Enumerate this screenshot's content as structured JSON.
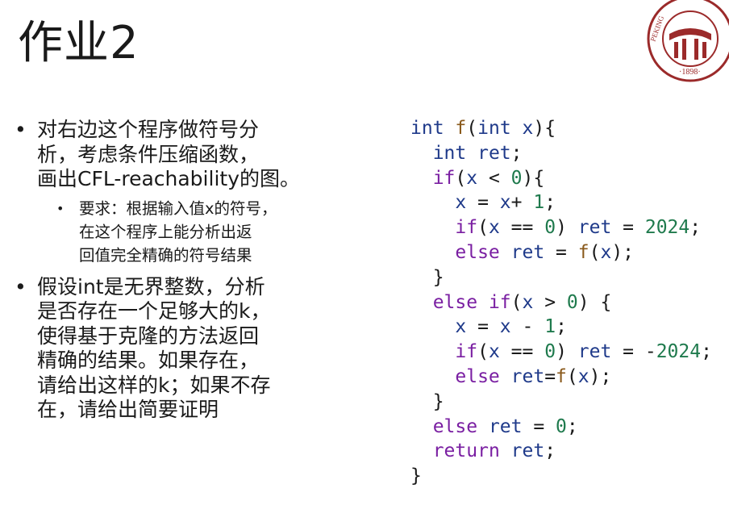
{
  "title": "作业2",
  "logo": {
    "name": "Peking University seal",
    "text_top": "PEKING",
    "text_year": "1898",
    "color": "#9b2a2a"
  },
  "bullets": [
    {
      "lines": [
        "对右边这个程序做符号分",
        "析，考虑条件压缩函数，",
        "画出CFL-reachability的图。"
      ],
      "sub": {
        "lines": [
          "要求：根据输入值x的符号，",
          "在这个程序上能分析出返",
          "回值完全精确的符号结果"
        ]
      }
    },
    {
      "lines": [
        "假设int是无界整数，分析",
        "是否存在一个足够大的k，",
        "使得基于克隆的方法返回",
        "精确的结果。如果存在，",
        "请给出这样的k；如果不存",
        "在，请给出简要证明"
      ]
    }
  ],
  "code_lines": [
    "int f(int x){",
    "  int ret;",
    "  if(x < 0){",
    "    x = x+ 1;",
    "    if(x == 0) ret = 2024;",
    "    else ret = f(x);",
    "  }",
    "  else if(x > 0) {",
    "    x = x - 1;",
    "    if(x == 0) ret = -2024;",
    "    else ret=f(x);",
    "  }",
    "  else ret = 0;",
    "  return ret;",
    "}"
  ],
  "colors": {
    "keyword": "#7a1fa2",
    "type": "#1f3a8a",
    "function": "#8a5a1c",
    "number": "#1f7a4d",
    "text": "#1a1a1a"
  }
}
